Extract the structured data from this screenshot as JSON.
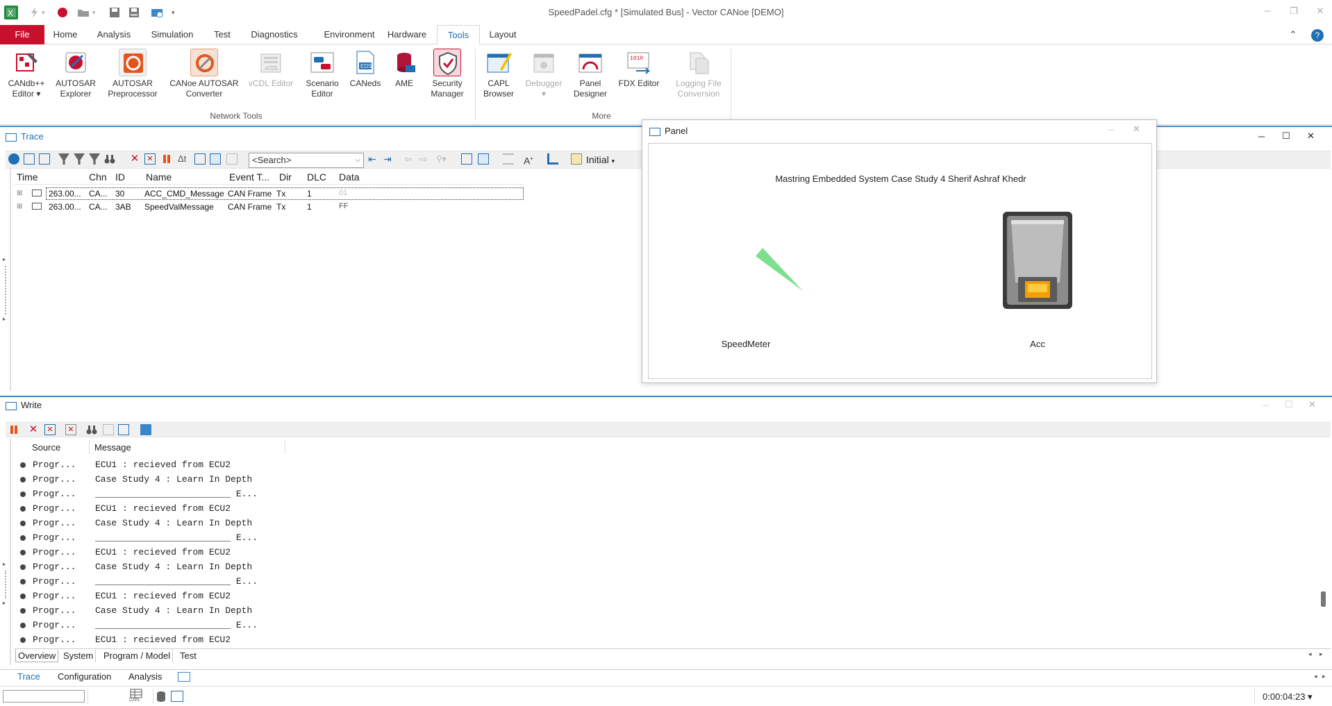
{
  "app": {
    "title": "SpeedPadel.cfg * [Simulated Bus] - Vector CANoe [DEMO]"
  },
  "menu": {
    "tabs": [
      "File",
      "Home",
      "Analysis",
      "Simulation",
      "Test",
      "Diagnostics",
      "Environment",
      "Hardware",
      "Tools",
      "Layout"
    ],
    "active": "Tools"
  },
  "ribbon": {
    "network_tools_label": "Network Tools",
    "more_label": "More",
    "buttons": [
      {
        "l1": "CANdb++",
        "l2": "Editor ▾",
        "icon": "candb-icon",
        "enabled": true
      },
      {
        "l1": "AUTOSAR",
        "l2": "Explorer",
        "icon": "autosar-explorer-icon",
        "enabled": true
      },
      {
        "l1": "AUTOSAR",
        "l2": "Preprocessor",
        "icon": "autosar-preprocessor-icon",
        "enabled": true
      },
      {
        "l1": "CANoe AUTOSAR",
        "l2": "Converter",
        "icon": "autosar-converter-icon",
        "enabled": true
      },
      {
        "l1": "vCDL Editor",
        "l2": "",
        "icon": "vcdl-icon",
        "enabled": false
      },
      {
        "l1": "Scenario",
        "l2": "Editor",
        "icon": "scenario-icon",
        "enabled": true
      },
      {
        "l1": "CANeds",
        "l2": "",
        "icon": "caneds-icon",
        "enabled": true
      },
      {
        "l1": "AME",
        "l2": "",
        "icon": "ame-icon",
        "enabled": true
      },
      {
        "l1": "Security",
        "l2": "Manager",
        "icon": "security-icon",
        "enabled": true
      },
      {
        "l1": "CAPL",
        "l2": "Browser",
        "icon": "capl-icon",
        "enabled": true
      },
      {
        "l1": "Debugger",
        "l2": "▾",
        "icon": "debugger-icon",
        "enabled": false
      },
      {
        "l1": "Panel",
        "l2": "Designer",
        "icon": "panel-designer-icon",
        "enabled": true
      },
      {
        "l1": "FDX Editor",
        "l2": "",
        "icon": "fdx-icon",
        "enabled": true
      },
      {
        "l1": "Logging File",
        "l2": "Conversion",
        "icon": "logging-icon",
        "enabled": false
      }
    ]
  },
  "trace": {
    "title": "Trace",
    "search_placeholder": "<Search>",
    "initial_label": "Initial",
    "columns": [
      "Time",
      "Chn",
      "ID",
      "Name",
      "Event T...",
      "Dir",
      "DLC",
      "Data"
    ],
    "rows": [
      {
        "time": "263.00...",
        "chn": "CA...",
        "id": "30",
        "name": "ACC_CMD_Message",
        "event": "CAN Frame",
        "dir": "Tx",
        "dlc": "1",
        "data": "01"
      },
      {
        "time": "263.00...",
        "chn": "CA...",
        "id": "3AB",
        "name": "SpeedValMessage",
        "event": "CAN Frame",
        "dir": "Tx",
        "dlc": "1",
        "data": "FF"
      }
    ]
  },
  "panel": {
    "title": "Panel",
    "heading": "Mastring Embedded System Case Study 4 Sherif Ashraf Khedr",
    "speedmeter_label": "SpeedMeter",
    "acc_label": "Acc"
  },
  "write": {
    "title": "Write",
    "columns": [
      "Source",
      "Message"
    ],
    "rows": [
      {
        "source": "Progr...",
        "message": "ECU1 : recieved from ECU2"
      },
      {
        "source": "Progr...",
        "message": "Case Study 4 : Learn In Depth"
      },
      {
        "source": "Progr...",
        "message": "_________________________ E..."
      },
      {
        "source": "Progr...",
        "message": "ECU1 : recieved from ECU2"
      },
      {
        "source": "Progr...",
        "message": "Case Study 4 : Learn In Depth"
      },
      {
        "source": "Progr...",
        "message": "_________________________ E..."
      },
      {
        "source": "Progr...",
        "message": "ECU1 : recieved from ECU2"
      },
      {
        "source": "Progr...",
        "message": "Case Study 4 : Learn In Depth"
      },
      {
        "source": "Progr...",
        "message": "_________________________ E..."
      },
      {
        "source": "Progr...",
        "message": "ECU1 : recieved from ECU2"
      },
      {
        "source": "Progr...",
        "message": "Case Study 4 : Learn In Depth"
      },
      {
        "source": "Progr...",
        "message": "_________________________ E..."
      },
      {
        "source": "Progr...",
        "message": "ECU1 : recieved from ECU2"
      }
    ],
    "tabs": [
      "Overview",
      "System",
      "Program / Model",
      "Test"
    ]
  },
  "bottom_tabs": [
    "Trace",
    "Configuration",
    "Analysis"
  ],
  "status": {
    "time": "0:00:04:23 ▾",
    "capl_label": "CAPL"
  },
  "colors": {
    "file_tab": "#c8102e",
    "accent": "#1f6fb5",
    "needle": "#7ee08f",
    "lamp": "#f0a000"
  }
}
